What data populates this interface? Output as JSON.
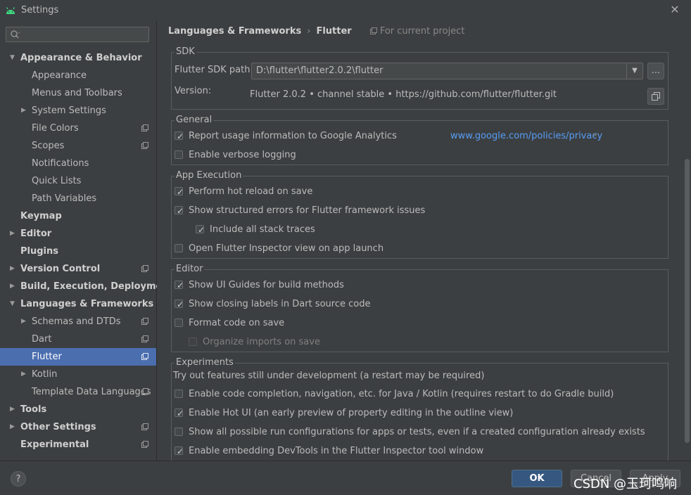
{
  "window": {
    "title": "Settings"
  },
  "sidebar": {
    "search_placeholder": "",
    "items": [
      {
        "label": "Appearance & Behavior"
      },
      {
        "label": "Appearance"
      },
      {
        "label": "Menus and Toolbars"
      },
      {
        "label": "System Settings"
      },
      {
        "label": "File Colors"
      },
      {
        "label": "Scopes"
      },
      {
        "label": "Notifications"
      },
      {
        "label": "Quick Lists"
      },
      {
        "label": "Path Variables"
      },
      {
        "label": "Keymap"
      },
      {
        "label": "Editor"
      },
      {
        "label": "Plugins"
      },
      {
        "label": "Version Control"
      },
      {
        "label": "Build, Execution, Deployment"
      },
      {
        "label": "Languages & Frameworks"
      },
      {
        "label": "Schemas and DTDs"
      },
      {
        "label": "Dart"
      },
      {
        "label": "Flutter"
      },
      {
        "label": "Kotlin"
      },
      {
        "label": "Template Data Languages"
      },
      {
        "label": "Tools"
      },
      {
        "label": "Other Settings"
      },
      {
        "label": "Experimental"
      }
    ]
  },
  "breadcrumb": {
    "parent": "Languages & Frameworks",
    "current": "Flutter",
    "note": "For current project"
  },
  "sdk": {
    "title": "SDK",
    "path_label": "Flutter SDK path:",
    "path_value": "D:\\flutter\\flutter2.0.2\\flutter",
    "browse_label": "...",
    "version_label": "Version:",
    "version_value": "Flutter 2.0.2 • channel stable • https://github.com/flutter/flutter.git"
  },
  "general": {
    "title": "General",
    "report_usage": "Report usage information to Google Analytics",
    "privacy_link": "www.google.com/policies/privacy",
    "link_arrow": "»",
    "verbose_logging": "Enable verbose logging"
  },
  "app_execution": {
    "title": "App Execution",
    "hot_reload": "Perform hot reload on save",
    "structured_errors": "Show structured errors for Flutter framework issues",
    "stack_traces": "Include all stack traces",
    "open_inspector": "Open Flutter Inspector view on app launch"
  },
  "editor": {
    "title": "Editor",
    "ui_guides": "Show UI Guides for build methods",
    "closing_labels": "Show closing labels in Dart source code",
    "format_on_save": "Format code on save",
    "organize_imports": "Organize imports on save"
  },
  "experiments": {
    "title": "Experiments",
    "note": "Try out features still under development (a restart may be required)",
    "code_completion": "Enable code completion, navigation, etc. for Java / Kotlin (requires restart to do Gradle build)",
    "hot_ui": "Enable Hot UI (an early preview of property editing in the outline view)",
    "run_configs": "Show all possible run configurations for apps or tests, even if a created configuration already exists",
    "devtools": "Enable embedding DevTools in the Flutter Inspector tool window"
  },
  "footer": {
    "help": "?",
    "ok": "OK",
    "cancel": "Cancel",
    "apply": "Apply",
    "watermark": "CSDN @玉珂鸣响"
  },
  "colors": {
    "background": "#3c3f41",
    "selected": "#4b6eaf",
    "link": "#589df6",
    "ok_button": "#365880"
  },
  "icons": {
    "app": "android-icon",
    "search": "search-icon",
    "project": "project-scope-icon",
    "copy": "copy-icon"
  }
}
